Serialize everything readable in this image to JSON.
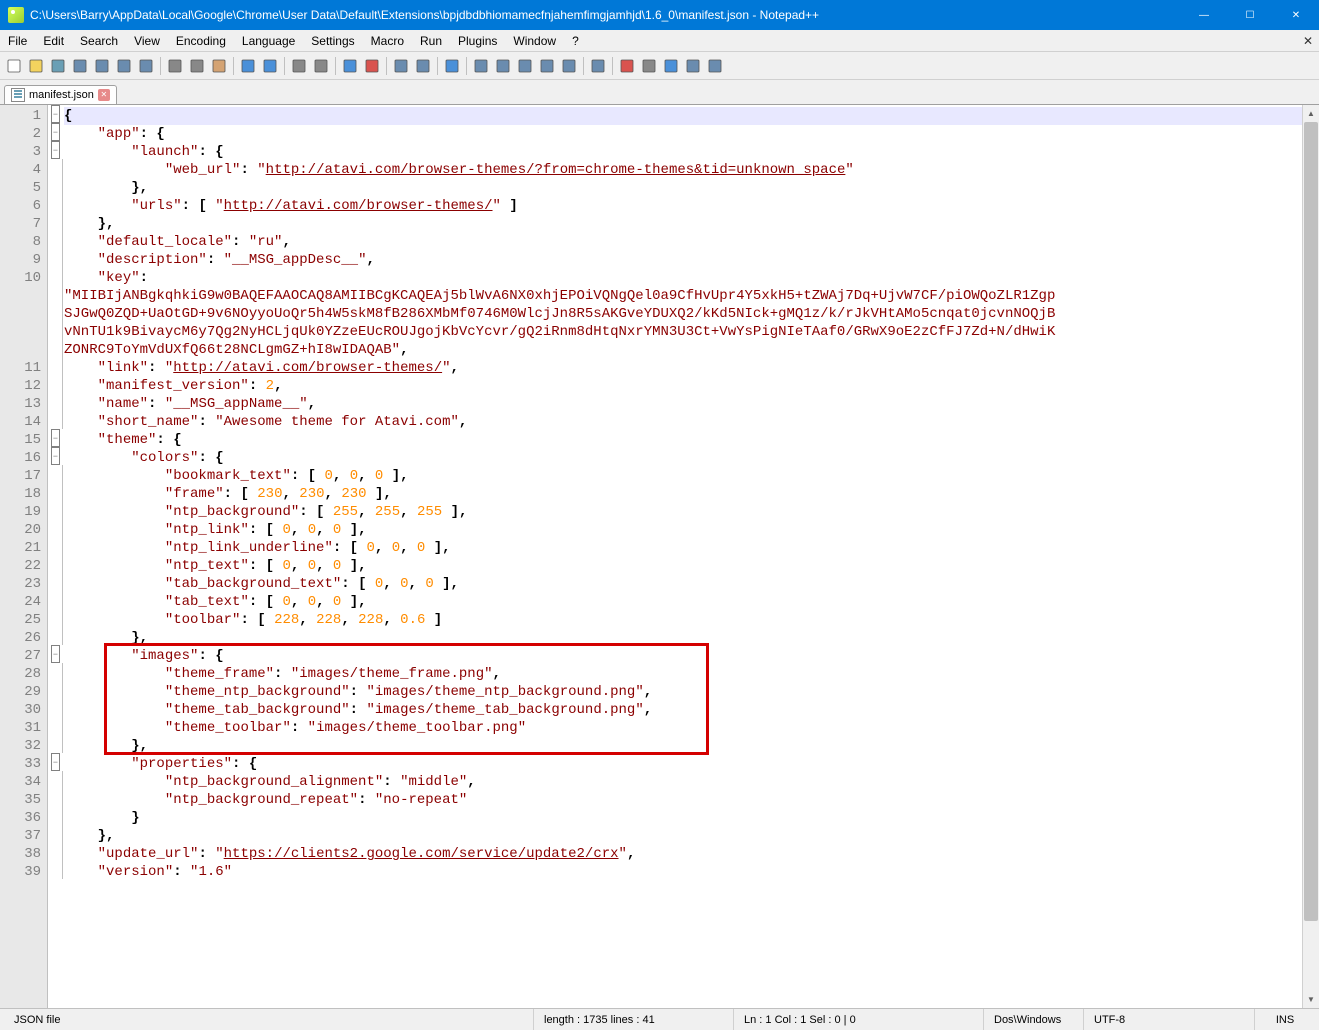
{
  "window": {
    "title": "C:\\Users\\Barry\\AppData\\Local\\Google\\Chrome\\User Data\\Default\\Extensions\\bpjdbdbhiomamecfnjahemfimgjamhjd\\1.6_0\\manifest.json - Notepad++",
    "min": "—",
    "max": "☐",
    "close": "✕"
  },
  "menu": [
    "File",
    "Edit",
    "Search",
    "View",
    "Encoding",
    "Language",
    "Settings",
    "Macro",
    "Run",
    "Plugins",
    "Window",
    "?"
  ],
  "tab": {
    "label": "manifest.json"
  },
  "code": {
    "lines": [
      {
        "n": 1,
        "fold": "box",
        "html": "<span class='p'>{</span>"
      },
      {
        "n": 2,
        "fold": "box",
        "html": "    <span class='k'>\"app\"</span><span class='p'>: {</span>"
      },
      {
        "n": 3,
        "fold": "box",
        "html": "        <span class='k'>\"launch\"</span><span class='p'>: {</span>"
      },
      {
        "n": 4,
        "fold": "line",
        "html": "            <span class='k'>\"web_url\"</span><span class='p'>:</span> <span class='s'>\"</span><span class='u'>http://atavi.com/browser-themes/?from=chrome-themes&amp;tid=unknown_space</span><span class='s'>\"</span>"
      },
      {
        "n": 5,
        "fold": "line",
        "html": "        <span class='p'>},</span>"
      },
      {
        "n": 6,
        "fold": "line",
        "html": "        <span class='k'>\"urls\"</span><span class='p'>: [</span> <span class='s'>\"</span><span class='u'>http://atavi.com/browser-themes/</span><span class='s'>\"</span> <span class='p'>]</span>"
      },
      {
        "n": 7,
        "fold": "line",
        "html": "    <span class='p'>},</span>"
      },
      {
        "n": 8,
        "fold": "line",
        "html": "    <span class='k'>\"default_locale\"</span><span class='p'>:</span> <span class='s'>\"ru\"</span><span class='p'>,</span>"
      },
      {
        "n": 9,
        "fold": "line",
        "html": "    <span class='k'>\"description\"</span><span class='p'>:</span> <span class='s'>\"__MSG_appDesc__\"</span><span class='p'>,</span>"
      },
      {
        "n": 10,
        "fold": "line",
        "html": "    <span class='k'>\"key\"</span><span class='p'>:</span>"
      },
      {
        "n": "",
        "fold": "line",
        "html": "<span class='s'>\"MIIBIjANBgkqhkiG9w0BAQEFAAOCAQ8AMIIBCgKCAQEAj5blWvA6NX0xhjEPOiVQNgQel0a9CfHvUpr4Y5xkH5+tZWAj7Dq+UjvW7CF/piOWQoZLR1Zgp</span>"
      },
      {
        "n": "",
        "fold": "line",
        "html": "<span class='s'>SJGwQ0ZQD+UaOtGD+9v6NOyyoUoQr5h4W5skM8fB286XMbMf0746M0WlcjJn8R5sAKGveYDUXQ2/kKd5NIck+gMQ1z/k/rJkVHtAMo5cnqat0jcvnNOQjB</span>"
      },
      {
        "n": "",
        "fold": "line",
        "html": "<span class='s'>vNnTU1k9BivaycM6y7Qg2NyHCLjqUk0YZzeEUcROUJgojKbVcYcvr/gQ2iRnm8dHtqNxrYMN3U3Ct+VwYsPigNIeTAaf0/GRwX9oE2zCfFJ7Zd+N/dHwiK</span>"
      },
      {
        "n": "",
        "fold": "line",
        "html": "<span class='s'>ZONRC9ToYmVdUXfQ66t28NCLgmGZ+hI8wIDAQAB\"</span><span class='p'>,</span>"
      },
      {
        "n": 11,
        "fold": "line",
        "html": "    <span class='k'>\"link\"</span><span class='p'>:</span> <span class='s'>\"</span><span class='u'>http://atavi.com/browser-themes/</span><span class='s'>\"</span><span class='p'>,</span>"
      },
      {
        "n": 12,
        "fold": "line",
        "html": "    <span class='k'>\"manifest_version\"</span><span class='p'>:</span> <span class='n'>2</span><span class='p'>,</span>"
      },
      {
        "n": 13,
        "fold": "line",
        "html": "    <span class='k'>\"name\"</span><span class='p'>:</span> <span class='s'>\"__MSG_appName__\"</span><span class='p'>,</span>"
      },
      {
        "n": 14,
        "fold": "line",
        "html": "    <span class='k'>\"short_name\"</span><span class='p'>:</span> <span class='s'>\"Awesome theme for Atavi.com\"</span><span class='p'>,</span>"
      },
      {
        "n": 15,
        "fold": "box",
        "html": "    <span class='k'>\"theme\"</span><span class='p'>: {</span>"
      },
      {
        "n": 16,
        "fold": "box",
        "html": "        <span class='k'>\"colors\"</span><span class='p'>: {</span>"
      },
      {
        "n": 17,
        "fold": "line",
        "html": "            <span class='k'>\"bookmark_text\"</span><span class='p'>: [</span> <span class='n'>0</span><span class='p'>,</span> <span class='n'>0</span><span class='p'>,</span> <span class='n'>0</span> <span class='p'>],</span>"
      },
      {
        "n": 18,
        "fold": "line",
        "html": "            <span class='k'>\"frame\"</span><span class='p'>: [</span> <span class='n'>230</span><span class='p'>,</span> <span class='n'>230</span><span class='p'>,</span> <span class='n'>230</span> <span class='p'>],</span>"
      },
      {
        "n": 19,
        "fold": "line",
        "html": "            <span class='k'>\"ntp_background\"</span><span class='p'>: [</span> <span class='n'>255</span><span class='p'>,</span> <span class='n'>255</span><span class='p'>,</span> <span class='n'>255</span> <span class='p'>],</span>"
      },
      {
        "n": 20,
        "fold": "line",
        "html": "            <span class='k'>\"ntp_link\"</span><span class='p'>: [</span> <span class='n'>0</span><span class='p'>,</span> <span class='n'>0</span><span class='p'>,</span> <span class='n'>0</span> <span class='p'>],</span>"
      },
      {
        "n": 21,
        "fold": "line",
        "html": "            <span class='k'>\"ntp_link_underline\"</span><span class='p'>: [</span> <span class='n'>0</span><span class='p'>,</span> <span class='n'>0</span><span class='p'>,</span> <span class='n'>0</span> <span class='p'>],</span>"
      },
      {
        "n": 22,
        "fold": "line",
        "html": "            <span class='k'>\"ntp_text\"</span><span class='p'>: [</span> <span class='n'>0</span><span class='p'>,</span> <span class='n'>0</span><span class='p'>,</span> <span class='n'>0</span> <span class='p'>],</span>"
      },
      {
        "n": 23,
        "fold": "line",
        "html": "            <span class='k'>\"tab_background_text\"</span><span class='p'>: [</span> <span class='n'>0</span><span class='p'>,</span> <span class='n'>0</span><span class='p'>,</span> <span class='n'>0</span> <span class='p'>],</span>"
      },
      {
        "n": 24,
        "fold": "line",
        "html": "            <span class='k'>\"tab_text\"</span><span class='p'>: [</span> <span class='n'>0</span><span class='p'>,</span> <span class='n'>0</span><span class='p'>,</span> <span class='n'>0</span> <span class='p'>],</span>"
      },
      {
        "n": 25,
        "fold": "line",
        "html": "            <span class='k'>\"toolbar\"</span><span class='p'>: [</span> <span class='n'>228</span><span class='p'>,</span> <span class='n'>228</span><span class='p'>,</span> <span class='n'>228</span><span class='p'>,</span> <span class='n'>0.6</span> <span class='p'>]</span>"
      },
      {
        "n": 26,
        "fold": "line",
        "html": "        <span class='p'>},</span>"
      },
      {
        "n": 27,
        "fold": "box",
        "html": "        <span class='k'>\"images\"</span><span class='p'>: {</span>"
      },
      {
        "n": 28,
        "fold": "line",
        "html": "            <span class='k'>\"theme_frame\"</span><span class='p'>:</span> <span class='s'>\"images/theme_frame.png\"</span><span class='p'>,</span>"
      },
      {
        "n": 29,
        "fold": "line",
        "html": "            <span class='k'>\"theme_ntp_background\"</span><span class='p'>:</span> <span class='s'>\"images/theme_ntp_background.png\"</span><span class='p'>,</span>"
      },
      {
        "n": 30,
        "fold": "line",
        "html": "            <span class='k'>\"theme_tab_background\"</span><span class='p'>:</span> <span class='s'>\"images/theme_tab_background.png\"</span><span class='p'>,</span>"
      },
      {
        "n": 31,
        "fold": "line",
        "html": "            <span class='k'>\"theme_toolbar\"</span><span class='p'>:</span> <span class='s'>\"images/theme_toolbar.png\"</span>"
      },
      {
        "n": 32,
        "fold": "line",
        "html": "        <span class='p'>},</span>"
      },
      {
        "n": 33,
        "fold": "box",
        "html": "        <span class='k'>\"properties\"</span><span class='p'>: {</span>"
      },
      {
        "n": 34,
        "fold": "line",
        "html": "            <span class='k'>\"ntp_background_alignment\"</span><span class='p'>:</span> <span class='s'>\"middle\"</span><span class='p'>,</span>"
      },
      {
        "n": 35,
        "fold": "line",
        "html": "            <span class='k'>\"ntp_background_repeat\"</span><span class='p'>:</span> <span class='s'>\"no-repeat\"</span>"
      },
      {
        "n": 36,
        "fold": "line",
        "html": "        <span class='p'>}</span>"
      },
      {
        "n": 37,
        "fold": "line",
        "html": "    <span class='p'>},</span>"
      },
      {
        "n": 38,
        "fold": "line",
        "html": "    <span class='k'>\"update_url\"</span><span class='p'>:</span> <span class='s'>\"</span><span class='u'>https://clients2.google.com/service/update2/crx</span><span class='s'>\"</span><span class='p'>,</span>"
      },
      {
        "n": 39,
        "fold": "line",
        "html": "    <span class='k'>\"version\"</span><span class='p'>:</span> <span class='s'>\"1.6\"</span>"
      }
    ],
    "highlight_box": {
      "from_line_idx": 30,
      "to_line_idx": 35
    }
  },
  "status": {
    "filetype": "JSON file",
    "length": "length : 1735    lines : 41",
    "pos": "Ln : 1    Col : 1    Sel : 0 | 0",
    "eol": "Dos\\Windows",
    "enc": "UTF-8",
    "mode": "INS"
  },
  "toolbar_icons": [
    "new",
    "open",
    "save",
    "save-all",
    "close",
    "close-all",
    "print",
    "sep",
    "cut",
    "copy",
    "paste",
    "sep",
    "undo",
    "redo",
    "sep",
    "find",
    "replace",
    "sep",
    "zoom-in",
    "zoom-out",
    "sep",
    "sync-v",
    "sync-h",
    "sep",
    "wrap",
    "sep",
    "all-chars",
    "indent",
    "lang",
    "eol",
    "doc-map",
    "sep",
    "folder",
    "sep",
    "record",
    "stop",
    "play",
    "play-multi",
    "macro-list"
  ]
}
